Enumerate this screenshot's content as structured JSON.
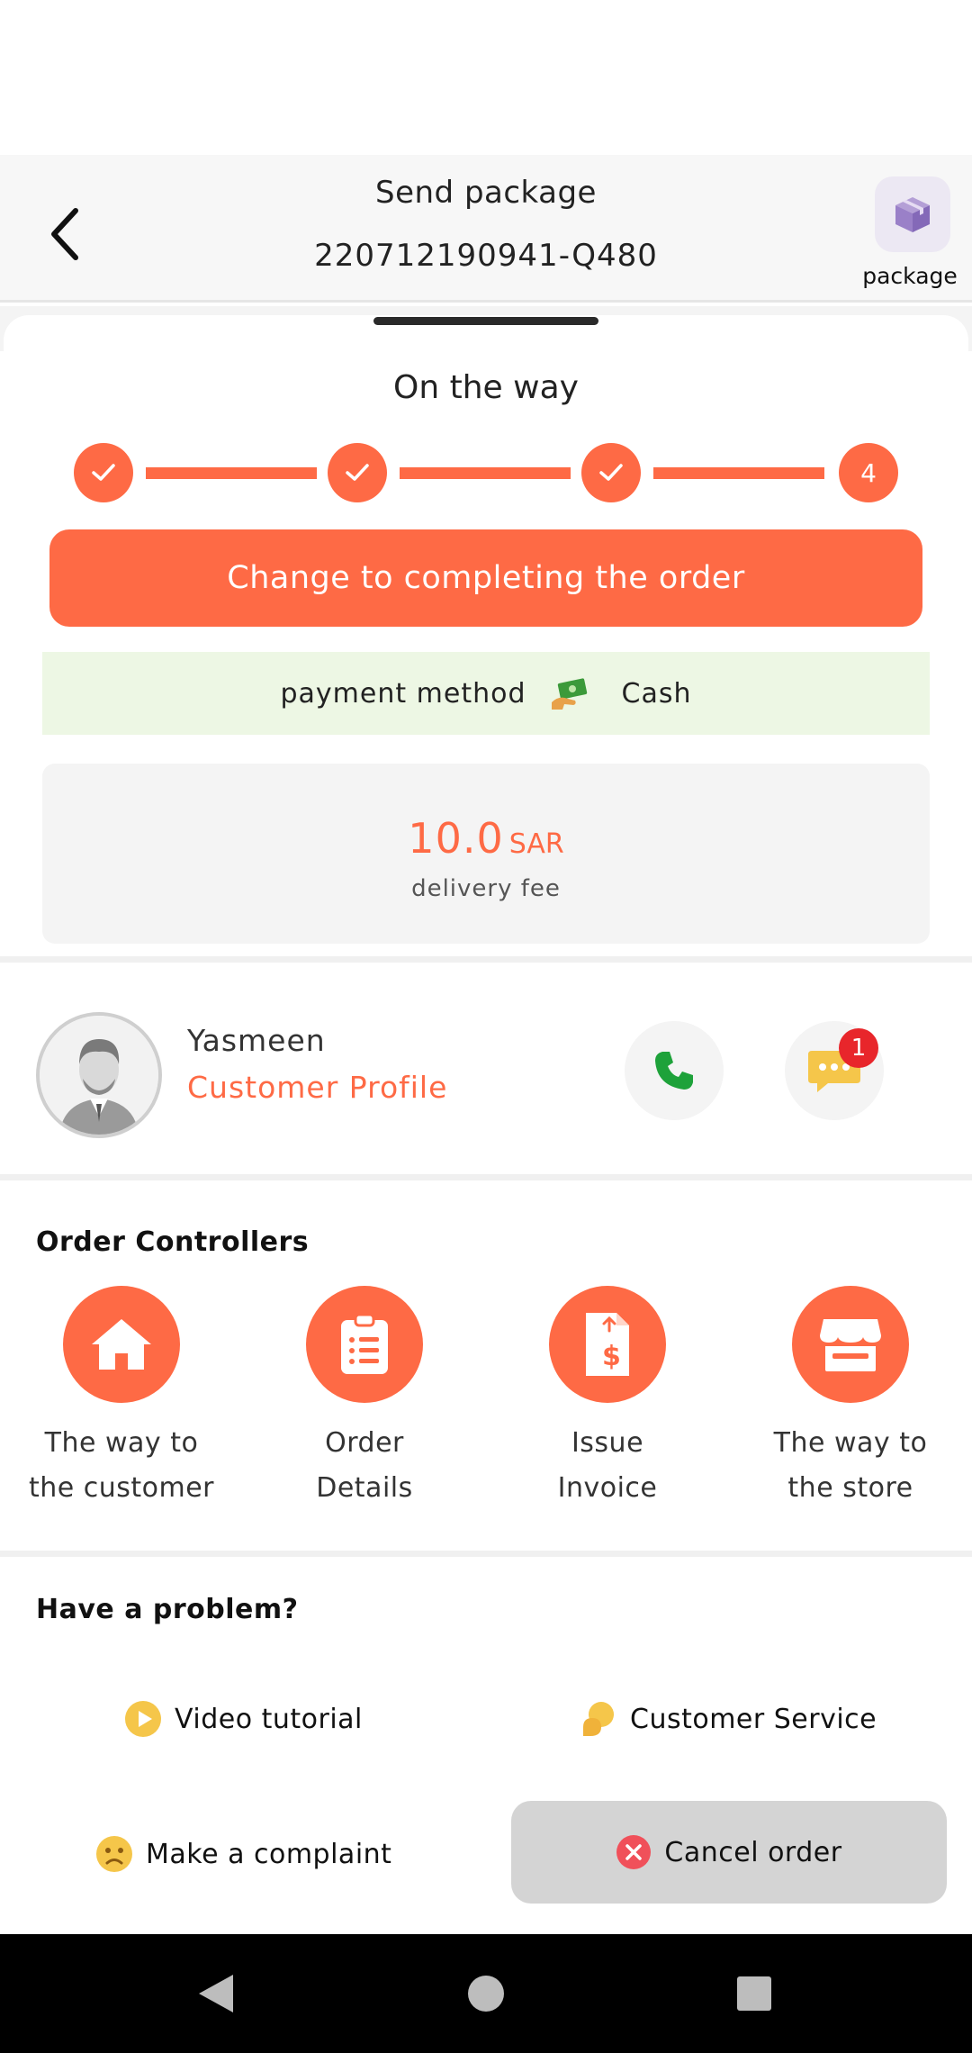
{
  "header": {
    "title": "Send package",
    "order_number": "220712190941-Q480",
    "package_label": "package"
  },
  "status": {
    "title": "On the way",
    "steps": [
      {
        "state": "done",
        "label": ""
      },
      {
        "state": "done",
        "label": ""
      },
      {
        "state": "done",
        "label": ""
      },
      {
        "state": "current",
        "label": "4"
      }
    ]
  },
  "cta": {
    "label": "Change to completing the order"
  },
  "payment": {
    "label": "payment method",
    "icon": "cash-hand-icon",
    "value": "Cash"
  },
  "fee": {
    "amount": "10.0",
    "currency": "SAR",
    "label": "delivery fee"
  },
  "customer": {
    "name": "Yasmeen",
    "profile_link": "Customer Profile",
    "chat_badge": "1"
  },
  "controllers": {
    "title": "Order Controllers",
    "items": [
      {
        "line1": "The way to",
        "line2": "the customer",
        "icon": "home-icon"
      },
      {
        "line1": "Order",
        "line2": "Details",
        "icon": "clipboard-list-icon"
      },
      {
        "line1": "Issue",
        "line2": "Invoice",
        "icon": "invoice-icon"
      },
      {
        "line1": "The way to",
        "line2": "the store",
        "icon": "store-icon"
      }
    ]
  },
  "help": {
    "title": "Have a problem?",
    "video": "Video tutorial",
    "service": "Customer Service",
    "complaint": "Make a complaint",
    "cancel": "Cancel order"
  },
  "colors": {
    "accent": "#fe6a45",
    "payment_bg": "#edf7e4",
    "call_green": "#1ea23a",
    "badge_red": "#e8262b",
    "help_yellow": "#f5c64a"
  }
}
